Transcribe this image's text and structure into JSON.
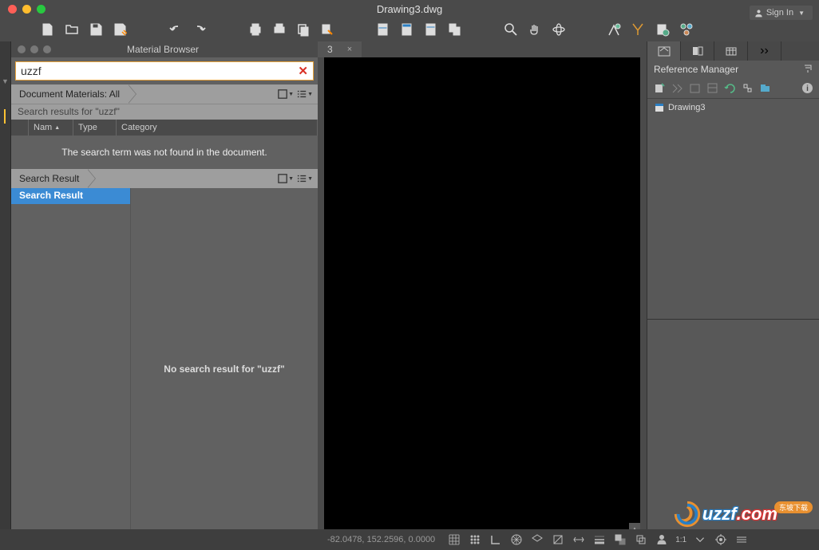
{
  "window": {
    "title": "Drawing3.dwg",
    "signin": "Sign In"
  },
  "material_browser": {
    "title": "Material Browser",
    "search_value": "uzzf",
    "crumb": "Document Materials: All",
    "sub_header": "Search results for \"uzzf\"",
    "columns": {
      "name": "Nam",
      "type": "Type",
      "category": "Category"
    },
    "empty_doc": "The search term was not found in the document.",
    "search_result_crumb": "Search Result",
    "tree_item": "Search Result",
    "no_result": "No search result for \"uzzf\""
  },
  "tab": {
    "suffix": "3"
  },
  "right_panel": {
    "title": "Reference Manager",
    "tree_item": "Drawing3"
  },
  "statusbar": {
    "coords": "-82.0478, 152.2596, 0.0000",
    "scale": "1:1"
  },
  "watermark": {
    "text1": "uzzf",
    "text2": ".com",
    "badge": "东坡下载"
  }
}
